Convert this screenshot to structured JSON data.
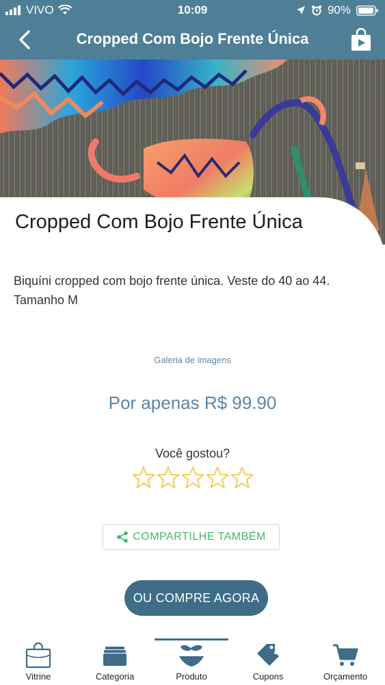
{
  "status": {
    "carrier": "VIVO",
    "time": "10:09",
    "battery": "90%"
  },
  "nav": {
    "title": "Cropped Com Bojo Frente Única"
  },
  "product": {
    "title": "Cropped Com Bojo Frente Única",
    "description": "Biquíni cropped com bojo frente única. Veste do 40 ao 44. Tamanho M",
    "gallery_link": "Galeria de imagens",
    "price": "Por apenas R$ 99.90",
    "rating_prompt": "Você gostou?",
    "rating": 0,
    "rating_max": 5,
    "share_label": "COMPARTILHE TAMBÉM",
    "buy_label": "OU COMPRE AGORA"
  },
  "tabs": [
    {
      "label": "Vitrine",
      "icon": "shopping-bag-icon"
    },
    {
      "label": "Categoria",
      "icon": "folder-icon"
    },
    {
      "label": "Produto",
      "icon": "bikini-icon",
      "active": true
    },
    {
      "label": "Cupons",
      "icon": "tag-icon"
    },
    {
      "label": "Orçamento",
      "icon": "cart-icon"
    }
  ],
  "colors": {
    "brand": "#4f7f97",
    "button": "#3f6d88",
    "price": "#5c86a5",
    "share": "#3fb86a",
    "star": "#f2c94c"
  }
}
